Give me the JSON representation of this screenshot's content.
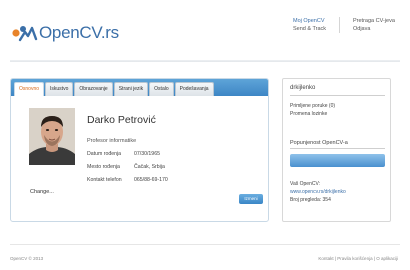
{
  "header": {
    "logo_text": "OpenCV.rs",
    "nav": {
      "my_opencv": "Moj OpenCV",
      "send_track": "Send & Track",
      "search_cv": "Pretraga CV-jeva",
      "logout": "Odjava"
    }
  },
  "tabs": [
    {
      "label": "Osnovno",
      "active": true
    },
    {
      "label": "Iskustvo",
      "active": false
    },
    {
      "label": "Obrazovanje",
      "active": false
    },
    {
      "label": "Strani jezik",
      "active": false
    },
    {
      "label": "Ostalo",
      "active": false
    },
    {
      "label": "Podešavanja",
      "active": false
    }
  ],
  "profile": {
    "change_photo": "Change...",
    "name": "Darko Petrović",
    "title": "Profesor informatike",
    "fields": [
      {
        "label": "Datum rođenja",
        "value": "07/30/1965"
      },
      {
        "label": "Mesto rođenja",
        "value": "Čačak, Srbija"
      },
      {
        "label": "Kontakt telefon",
        "value": "065/88-69-170"
      }
    ],
    "edit_label": "Izmeni"
  },
  "sidebar": {
    "username": "drkijlenko",
    "messages": "Primljene poruke (0)",
    "change_password": "Promena lozinke",
    "completeness_heading": "Popunjenost OpenCV-a",
    "your_opencv_label": "Vaš OpenCV:",
    "your_opencv_url": "www.opencv.rs/drkijlenko",
    "views": "Broj pregleda: 354"
  },
  "footer": {
    "copyright": "OpenCV © 2013",
    "links": "Kontakt | Pravila korišćenja | O aplikaciji"
  },
  "colors": {
    "brand_blue": "#3b6fa8",
    "logo_orange": "#e8842a",
    "tab_bar": "#4a92cf",
    "active_tab_text": "#d66a1a"
  }
}
